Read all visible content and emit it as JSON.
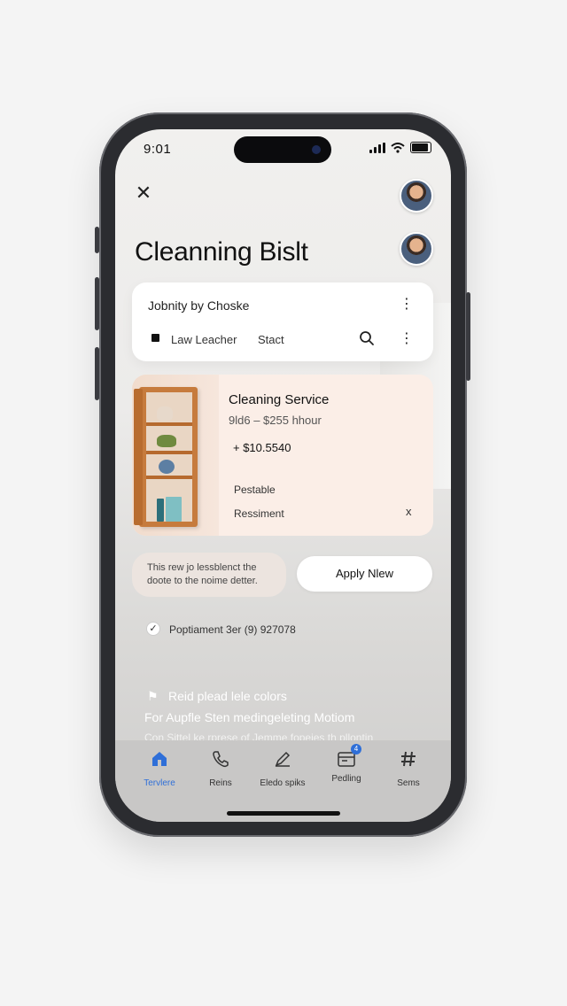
{
  "status": {
    "time": "9:01"
  },
  "header": {
    "title": "Cleanning Bislt"
  },
  "search_card": {
    "title": "Jobnity by Choske",
    "filter_1": "Law Leacher",
    "filter_2": "Stact"
  },
  "service_card": {
    "title": "Cleaning Service",
    "rate": "9ld6 – $255 hhour",
    "price": "+ $10.5540",
    "detail_1": "Pestable",
    "detail_2": "Ressiment",
    "close": "x"
  },
  "note": {
    "line_1": "This rew jo lessblenct the",
    "line_2": "doote to the noime detter."
  },
  "apply_button": {
    "label": "Apply Nlew"
  },
  "confirmation": {
    "text": "Poptiament 3er (9) 927078"
  },
  "promo": {
    "line_1": "Reid plead lele colors",
    "line_2": "For Aupfle Sten medingeleting Motiom",
    "line_3": "Con Sittel ke rprese of Jemme fopejes th pllontin"
  },
  "tabs": [
    {
      "label": "Tervlere",
      "icon": "home-icon",
      "active": true
    },
    {
      "label": "Reins",
      "icon": "phone-icon"
    },
    {
      "label": "Eledo spiks",
      "icon": "pen-icon"
    },
    {
      "label": "Pedling",
      "icon": "calendar-icon",
      "badge": "4"
    },
    {
      "label": "Sems",
      "icon": "hash-icon"
    }
  ],
  "colors": {
    "accent": "#2f6fd8",
    "card_peach": "#fbeee7"
  }
}
